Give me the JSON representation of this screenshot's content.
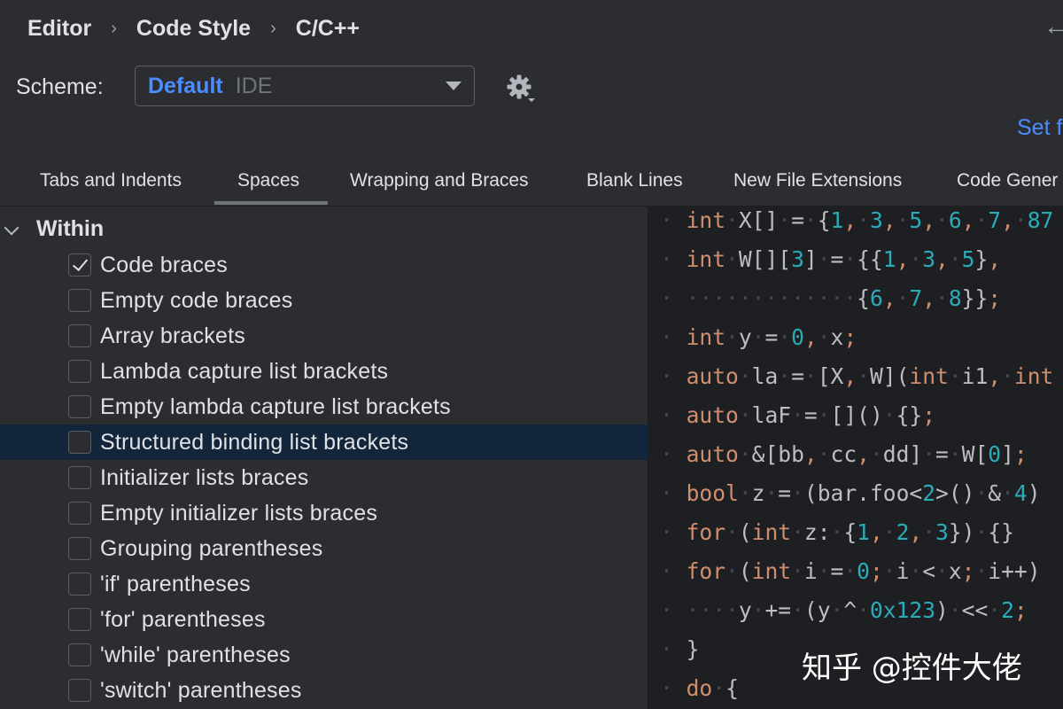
{
  "breadcrumb": [
    "Editor",
    "Code Style",
    "C/C++"
  ],
  "scheme": {
    "label": "Scheme:",
    "name": "Default",
    "tag": "IDE"
  },
  "link_text": "Set f",
  "tabs": [
    "Tabs and Indents",
    "Spaces",
    "Wrapping and Braces",
    "Blank Lines",
    "New File Extensions",
    "Code Gener"
  ],
  "active_tab": "Spaces",
  "group": {
    "label": "Within",
    "expanded": true
  },
  "options": [
    {
      "label": "Code braces",
      "checked": true
    },
    {
      "label": "Empty code braces",
      "checked": false
    },
    {
      "label": "Array brackets",
      "checked": false
    },
    {
      "label": "Lambda capture list brackets",
      "checked": false
    },
    {
      "label": "Empty lambda capture list brackets",
      "checked": false
    },
    {
      "label": "Structured binding list brackets",
      "checked": false,
      "selected": true
    },
    {
      "label": "Initializer lists braces",
      "checked": false
    },
    {
      "label": "Empty initializer lists braces",
      "checked": false
    },
    {
      "label": "Grouping parentheses",
      "checked": false
    },
    {
      "label": "'if' parentheses",
      "checked": false
    },
    {
      "label": "'for' parentheses",
      "checked": false
    },
    {
      "label": "'while' parentheses",
      "checked": false
    },
    {
      "label": "'switch' parentheses",
      "checked": false
    }
  ],
  "code_lines": [
    "int X[] = {1, 3, 5, 6, 7, 87",
    "int W[][3] = {{1, 3, 5},",
    "             {6, 7, 8}};",
    "int y = 0, x;",
    "auto la = [X, W](int i1, int",
    "auto laF = []() {};",
    "auto &[bb, cc, dd] = W[0];",
    "bool z = (bar.foo<2>() & 4)",
    "for (int z: {1, 2, 3}) {}",
    "for (int i = 0; i < x; i++)",
    "    y += (y ^ 0x123) << 2;",
    "}",
    "do {"
  ],
  "icons": {
    "gear": "gear-icon",
    "back": "back-arrow-icon",
    "expand": "chevron-down-icon"
  },
  "colors": {
    "accent": "#4c8dff",
    "keyword": "#cf8e6d",
    "number": "#2aacb8",
    "selection": "#13253a"
  },
  "watermark": "知乎 @控件大佬"
}
